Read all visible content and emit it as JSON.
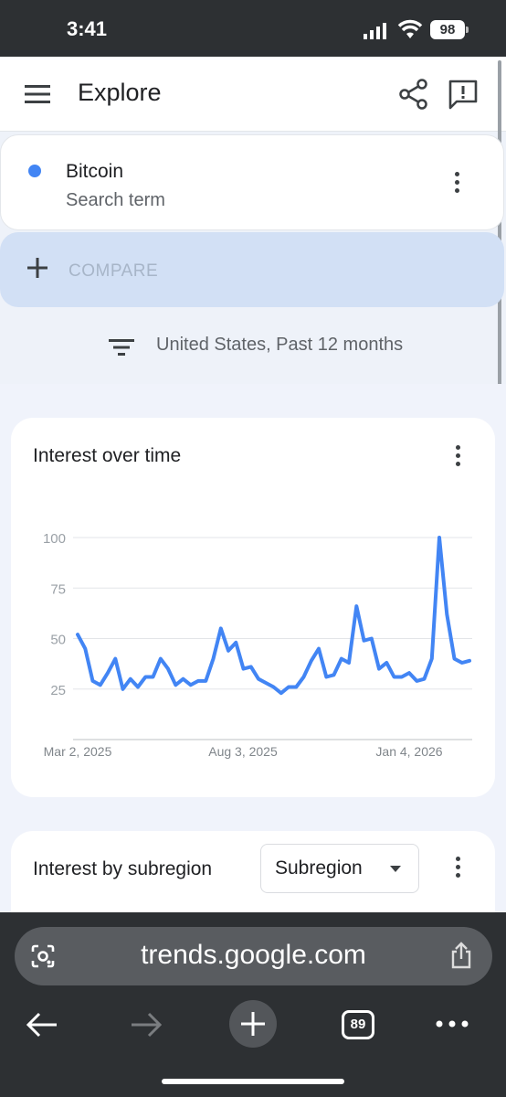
{
  "status_bar": {
    "time": "3:41",
    "battery": "98"
  },
  "header": {
    "title": "Explore"
  },
  "search_term": {
    "name": "Bitcoin",
    "subtitle": "Search term",
    "color": "#4285f4"
  },
  "compare": {
    "label": "COMPARE"
  },
  "filter": {
    "text": "United States, Past 12 months"
  },
  "interest_over_time": {
    "title": "Interest over time"
  },
  "chart_data": {
    "type": "line",
    "series": [
      {
        "values": [
          52,
          45,
          29,
          27,
          33,
          40,
          25,
          30,
          26,
          31,
          31,
          40,
          35,
          27,
          30,
          27,
          29,
          29,
          40,
          55,
          44,
          48,
          35,
          36,
          30,
          28,
          26,
          23,
          26,
          26,
          31,
          39,
          45,
          31,
          32,
          40,
          38,
          66,
          49,
          50,
          35,
          38,
          31,
          31,
          33,
          29,
          30,
          40,
          100,
          62,
          40,
          38,
          39
        ],
        "color": "#4285f4"
      }
    ],
    "x_tick_labels": [
      "Mar 2, 2025",
      "Aug 3, 2025",
      "Jan 4, 2026"
    ],
    "y_ticks": [
      25,
      50,
      75,
      100
    ],
    "ylim": [
      0,
      100
    ],
    "grid": true
  },
  "subregion": {
    "title": "Interest by subregion",
    "select_label": "Subregion"
  },
  "browser": {
    "url": "trends.google.com",
    "tab_count": "89"
  }
}
